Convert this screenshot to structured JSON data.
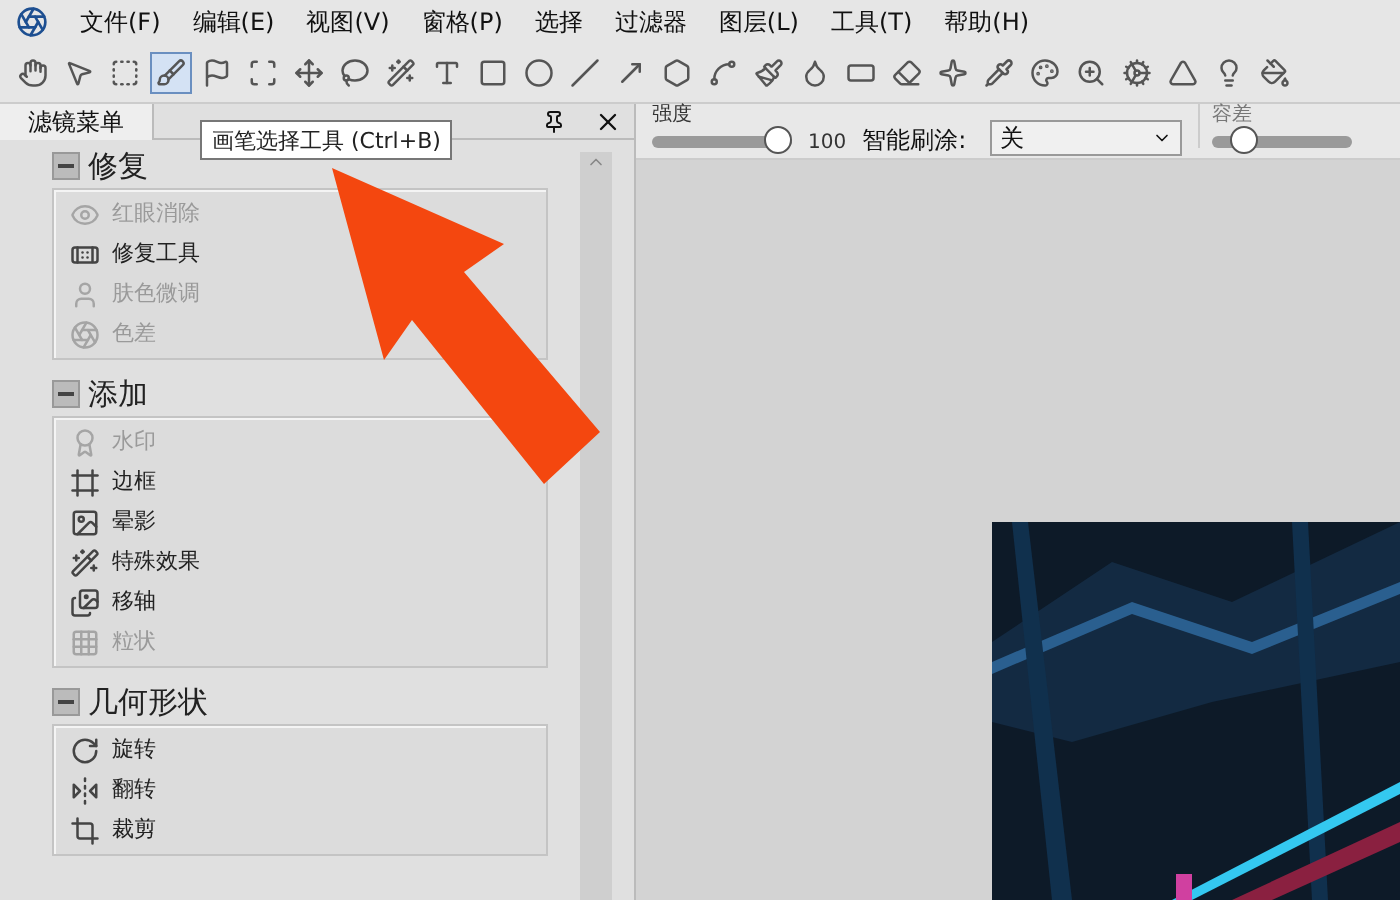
{
  "menu_bar": {
    "items": [
      "文件(F)",
      "编辑(E)",
      "视图(V)",
      "窗格(P)",
      "选择",
      "过滤器",
      "图层(L)",
      "工具(T)",
      "帮助(H)"
    ]
  },
  "toolbar": {
    "tools": [
      {
        "selected": false
      },
      {
        "selected": false
      },
      {
        "selected": false
      },
      {
        "selected": true
      },
      {
        "selected": false
      },
      {
        "selected": false
      },
      {
        "selected": false
      },
      {
        "selected": false
      },
      {
        "selected": false
      },
      {
        "selected": false
      },
      {
        "selected": false
      },
      {
        "selected": false
      },
      {
        "selected": false
      },
      {
        "selected": false
      },
      {
        "selected": false
      },
      {
        "selected": false
      },
      {
        "selected": false
      },
      {
        "selected": false
      },
      {
        "selected": false
      },
      {
        "selected": false
      },
      {
        "selected": false
      },
      {
        "selected": false
      },
      {
        "selected": false
      },
      {
        "selected": false
      },
      {
        "selected": false
      },
      {
        "selected": false
      },
      {
        "selected": false
      },
      {
        "selected": false
      }
    ]
  },
  "tooltip": "画笔选择工具 (Ctrl+B)",
  "panel": {
    "tab": "滤镜菜单",
    "sections": [
      {
        "title": "修复",
        "expanded": true,
        "items": [
          {
            "label": "红眼消除",
            "disabled": true
          },
          {
            "label": "修复工具",
            "disabled": false
          },
          {
            "label": "肤色微调",
            "disabled": true
          },
          {
            "label": "色差",
            "disabled": true
          }
        ]
      },
      {
        "title": "添加",
        "expanded": true,
        "items": [
          {
            "label": "水印",
            "disabled": true
          },
          {
            "label": "边框",
            "disabled": false
          },
          {
            "label": "晕影",
            "disabled": false
          },
          {
            "label": "特殊效果",
            "disabled": false
          },
          {
            "label": "移轴",
            "disabled": false
          },
          {
            "label": "粒状",
            "disabled": true
          }
        ]
      },
      {
        "title": "几何形状",
        "expanded": true,
        "items": [
          {
            "label": "旋转",
            "disabled": false
          },
          {
            "label": "翻转",
            "disabled": false
          },
          {
            "label": "裁剪",
            "disabled": false
          }
        ]
      }
    ]
  },
  "options_bar": {
    "strength_label": "强度",
    "strength": {
      "level": 1
    },
    "strength_value": "100",
    "smart_brush_label": "智能刷涂:",
    "smart_brush_value": "关",
    "tolerance_label": "容差",
    "tolerance": {
      "level": 0.15
    }
  }
}
